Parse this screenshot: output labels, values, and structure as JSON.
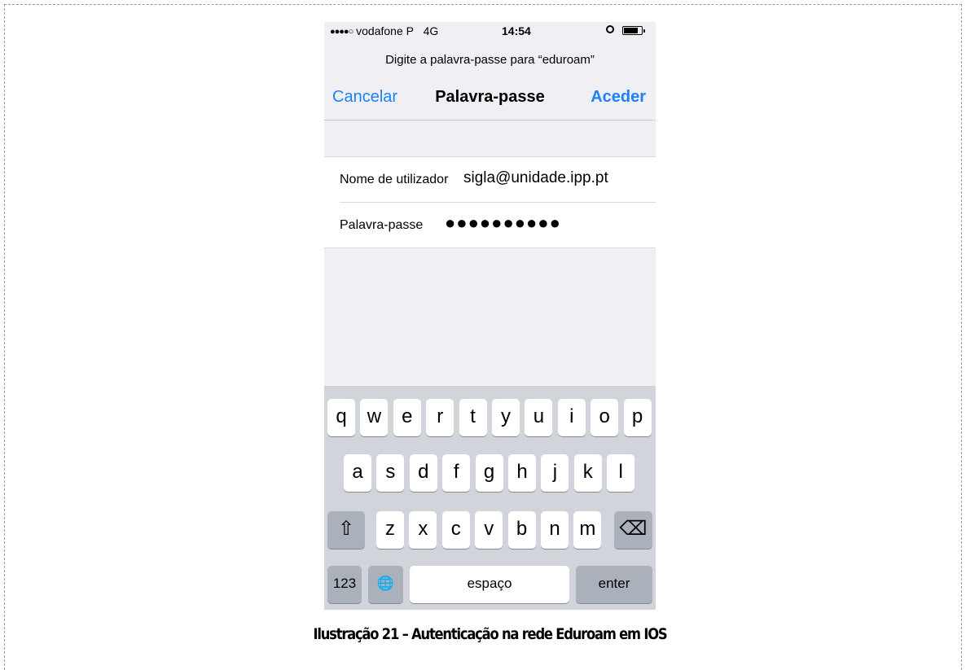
{
  "status_bar": {
    "signal_dots": "●●●●○",
    "carrier": "vodafone P",
    "network": "4G",
    "time": "14:54",
    "icons": [
      "alarm-icon",
      "battery-icon"
    ]
  },
  "prompt": "Digite a palavra-passe para “eduroam”",
  "navbar": {
    "cancel_label": "Cancelar",
    "title": "Palavra-passe",
    "access_label": "Aceder"
  },
  "form": {
    "username_label": "Nome de utilizador",
    "username_value": "sigla@unidade.ipp.pt",
    "password_label": "Palavra-passe",
    "password_value": "●●●●●●●●●●"
  },
  "keyboard": {
    "row1": [
      "q",
      "w",
      "e",
      "r",
      "t",
      "y",
      "u",
      "i",
      "o",
      "p"
    ],
    "row2": [
      "a",
      "s",
      "d",
      "f",
      "g",
      "h",
      "j",
      "k",
      "l"
    ],
    "row3": [
      "z",
      "x",
      "c",
      "v",
      "b",
      "n",
      "m"
    ],
    "shift_glyph": "⇧",
    "backspace_glyph": "⌫",
    "numbers_label": "123",
    "globe_glyph": "🌐",
    "space_label": "espaço",
    "enter_label": "enter"
  },
  "caption": "Ilustração 21 – Autenticação na rede Eduroam em IOS",
  "colors": {
    "accent": "#1a82fb",
    "keyboard_bg": "#d1d4da",
    "key_dark": "#abb1ba",
    "background": "#efeff4"
  }
}
